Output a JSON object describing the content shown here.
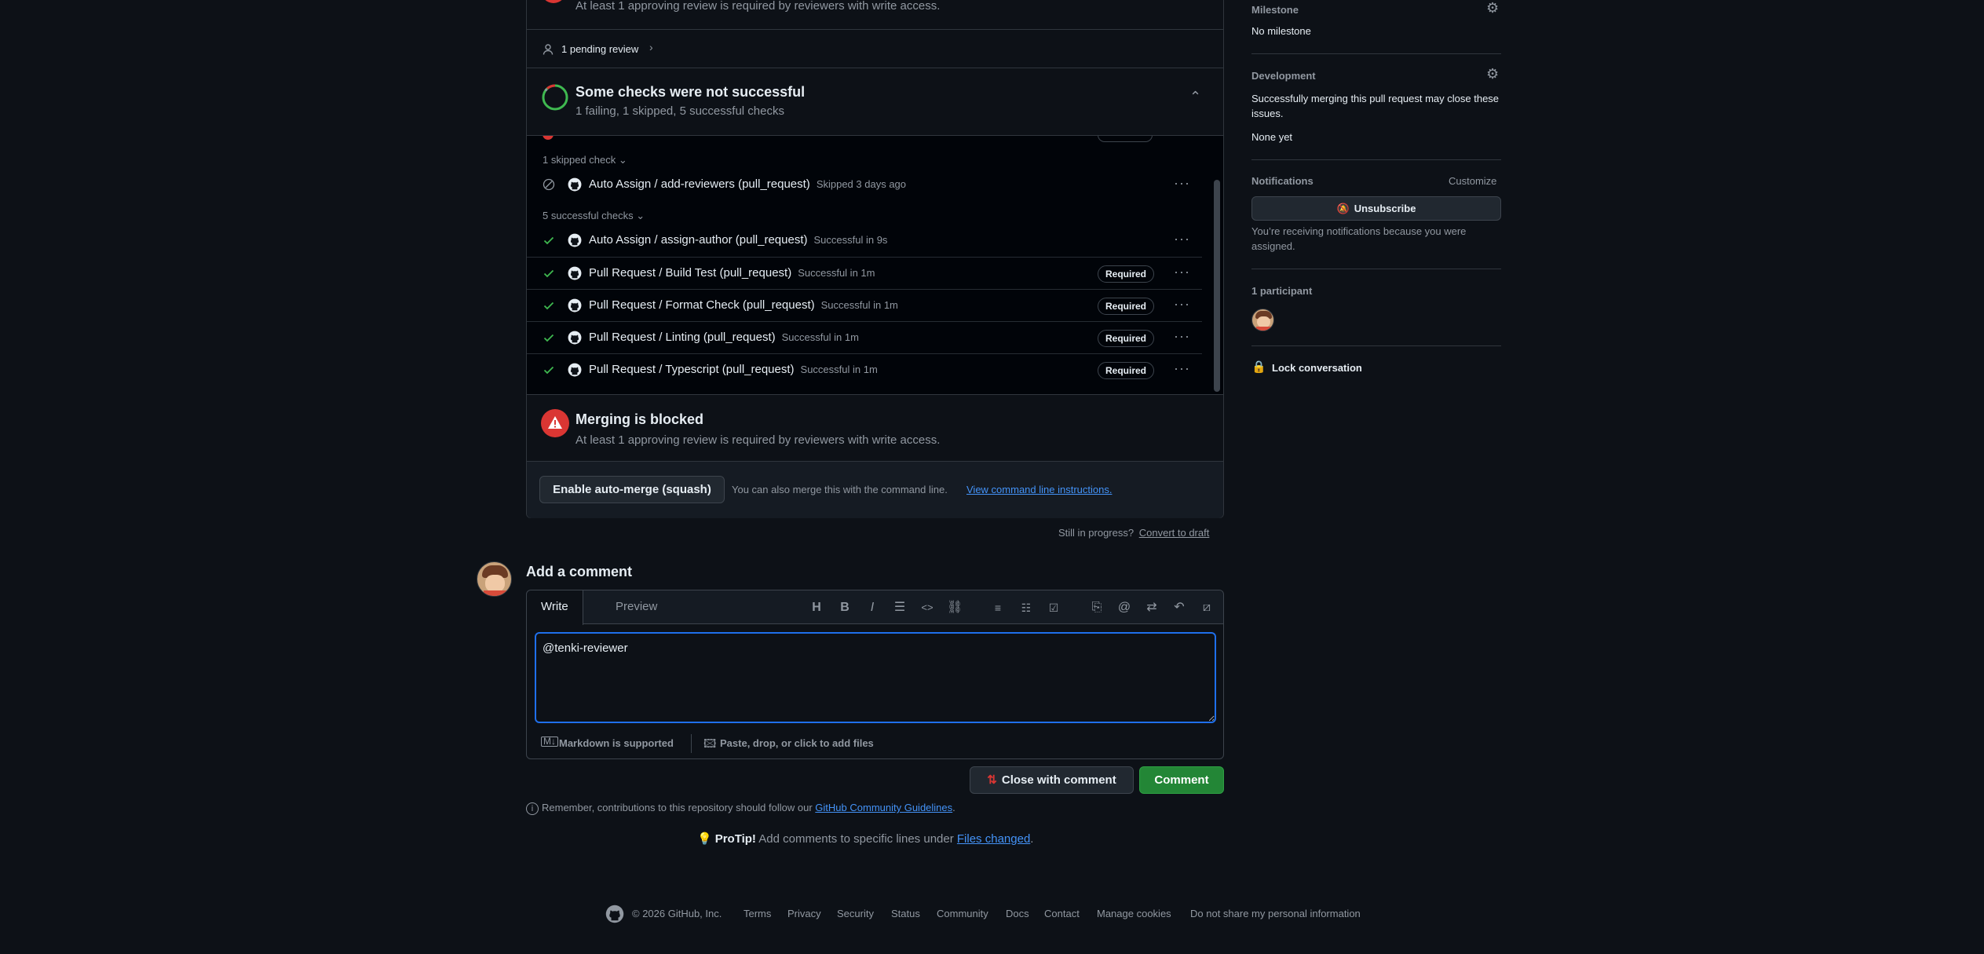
{
  "top_block": {
    "review_required_text": "At least 1 approving review is required by reviewers with write access.",
    "pending_review": "1 pending review"
  },
  "checks_header": {
    "title": "Some checks were not successful",
    "summary": "1 failing, 1 skipped, 5 successful checks"
  },
  "skipped_group": {
    "label": "1 skipped check",
    "checks": [
      {
        "name": "Auto Assign / add-reviewers (pull_request)",
        "meta": "Skipped 3 days ago",
        "required": false
      }
    ]
  },
  "successful_group": {
    "label": "5 successful checks",
    "checks": [
      {
        "name": "Auto Assign / assign-author (pull_request)",
        "meta": "Successful in 9s",
        "required": false
      },
      {
        "name": "Pull Request / Build Test (pull_request)",
        "meta": "Successful in 1m",
        "required": true
      },
      {
        "name": "Pull Request / Format Check (pull_request)",
        "meta": "Successful in 1m",
        "required": true
      },
      {
        "name": "Pull Request / Linting (pull_request)",
        "meta": "Successful in 1m",
        "required": true
      },
      {
        "name": "Pull Request / Typescript (pull_request)",
        "meta": "Successful in 1m",
        "required": true
      }
    ],
    "required_label": "Required"
  },
  "merge_blocked": {
    "title": "Merging is blocked",
    "text": "At least 1 approving review is required by reviewers with write access."
  },
  "auto_merge": {
    "button": "Enable auto-merge (squash)",
    "text": "You can also merge this with the command line.",
    "link": "View command line instructions."
  },
  "draft": {
    "text": "Still in progress?",
    "link": "Convert to draft"
  },
  "comment": {
    "heading": "Add a comment",
    "tab_write": "Write",
    "tab_preview": "Preview",
    "value": "@tenki-reviewer",
    "markdown_note": "Markdown is supported",
    "attach_note": "Paste, drop, or click to add files",
    "close_button": "Close with comment",
    "comment_button": "Comment",
    "guidelines_text": "Remember, contributions to this repository should follow our",
    "guidelines_link": "GitHub Community Guidelines",
    "protip_label": "ProTip!",
    "protip_text": "Add comments to specific lines under",
    "protip_link": "Files changed"
  },
  "sidebar": {
    "milestone_head": "Milestone",
    "milestone_value": "No milestone",
    "development_head": "Development",
    "development_text": "Successfully merging this pull request may close these issues.",
    "development_value": "None yet",
    "notifications_head": "Notifications",
    "customize": "Customize",
    "unsubscribe": "Unsubscribe",
    "notif_reason": "You’re receiving notifications because you were assigned.",
    "participants_head": "1 participant",
    "lock": "Lock conversation"
  },
  "footer": {
    "copyright": "© 2026 GitHub, Inc.",
    "links": [
      "Terms",
      "Privacy",
      "Security",
      "Status",
      "Community",
      "Docs",
      "Contact",
      "Manage cookies",
      "Do not share my personal information"
    ]
  },
  "colors": {
    "success": "#3fb950",
    "danger": "#da3633",
    "accent": "#4493f8"
  }
}
